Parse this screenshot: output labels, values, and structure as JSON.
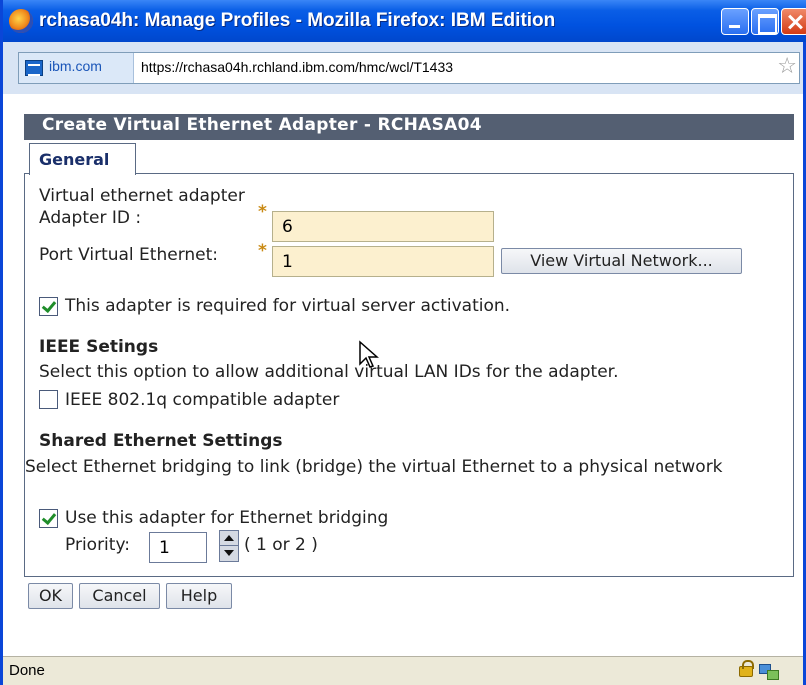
{
  "window": {
    "title": "rchasa04h: Manage Profiles - Mozilla Firefox: IBM Edition",
    "icon": "firefox-logo"
  },
  "address_bar": {
    "site_domain": "ibm.com",
    "url": "https://rchasa04h.rchland.ibm.com/hmc/wcl/T1433",
    "bookmark_icon": "star-icon"
  },
  "panel": {
    "title": "Create Virtual Ethernet Adapter - RCHASA04",
    "tab": "General"
  },
  "form": {
    "section_label": "Virtual ethernet adapter",
    "adapter_id_label": "Adapter ID :",
    "adapter_id_value": "6",
    "port_vlan_label": "Port Virtual Ethernet:",
    "port_vlan_value": "1",
    "required_marker": "*",
    "view_network_button": "View Virtual Network...",
    "required_activation_label": "This adapter is required for virtual server activation.",
    "required_activation_checked": true,
    "ieee": {
      "heading": "IEEE Setings",
      "description": "Select this option to allow additional virtual LAN IDs for the adapter.",
      "checkbox_label": "IEEE 802.1q compatible adapter",
      "checked": false
    },
    "shared": {
      "heading": "Shared Ethernet Settings",
      "description": "Select Ethernet bridging to link (bridge) the virtual Ethernet to a physical network",
      "checkbox_label": "Use this adapter for Ethernet bridging",
      "checked": true,
      "priority_label": "Priority:",
      "priority_value": "1",
      "priority_hint": "( 1 or 2 )"
    }
  },
  "actions": {
    "ok": "OK",
    "cancel": "Cancel",
    "help": "Help"
  },
  "status_bar": {
    "text": "Done"
  },
  "colors": {
    "titlebar": "#0052e0",
    "panel_header": "#545f72",
    "field_bg": "#fcf0cf",
    "required_star": "#c98a14"
  }
}
